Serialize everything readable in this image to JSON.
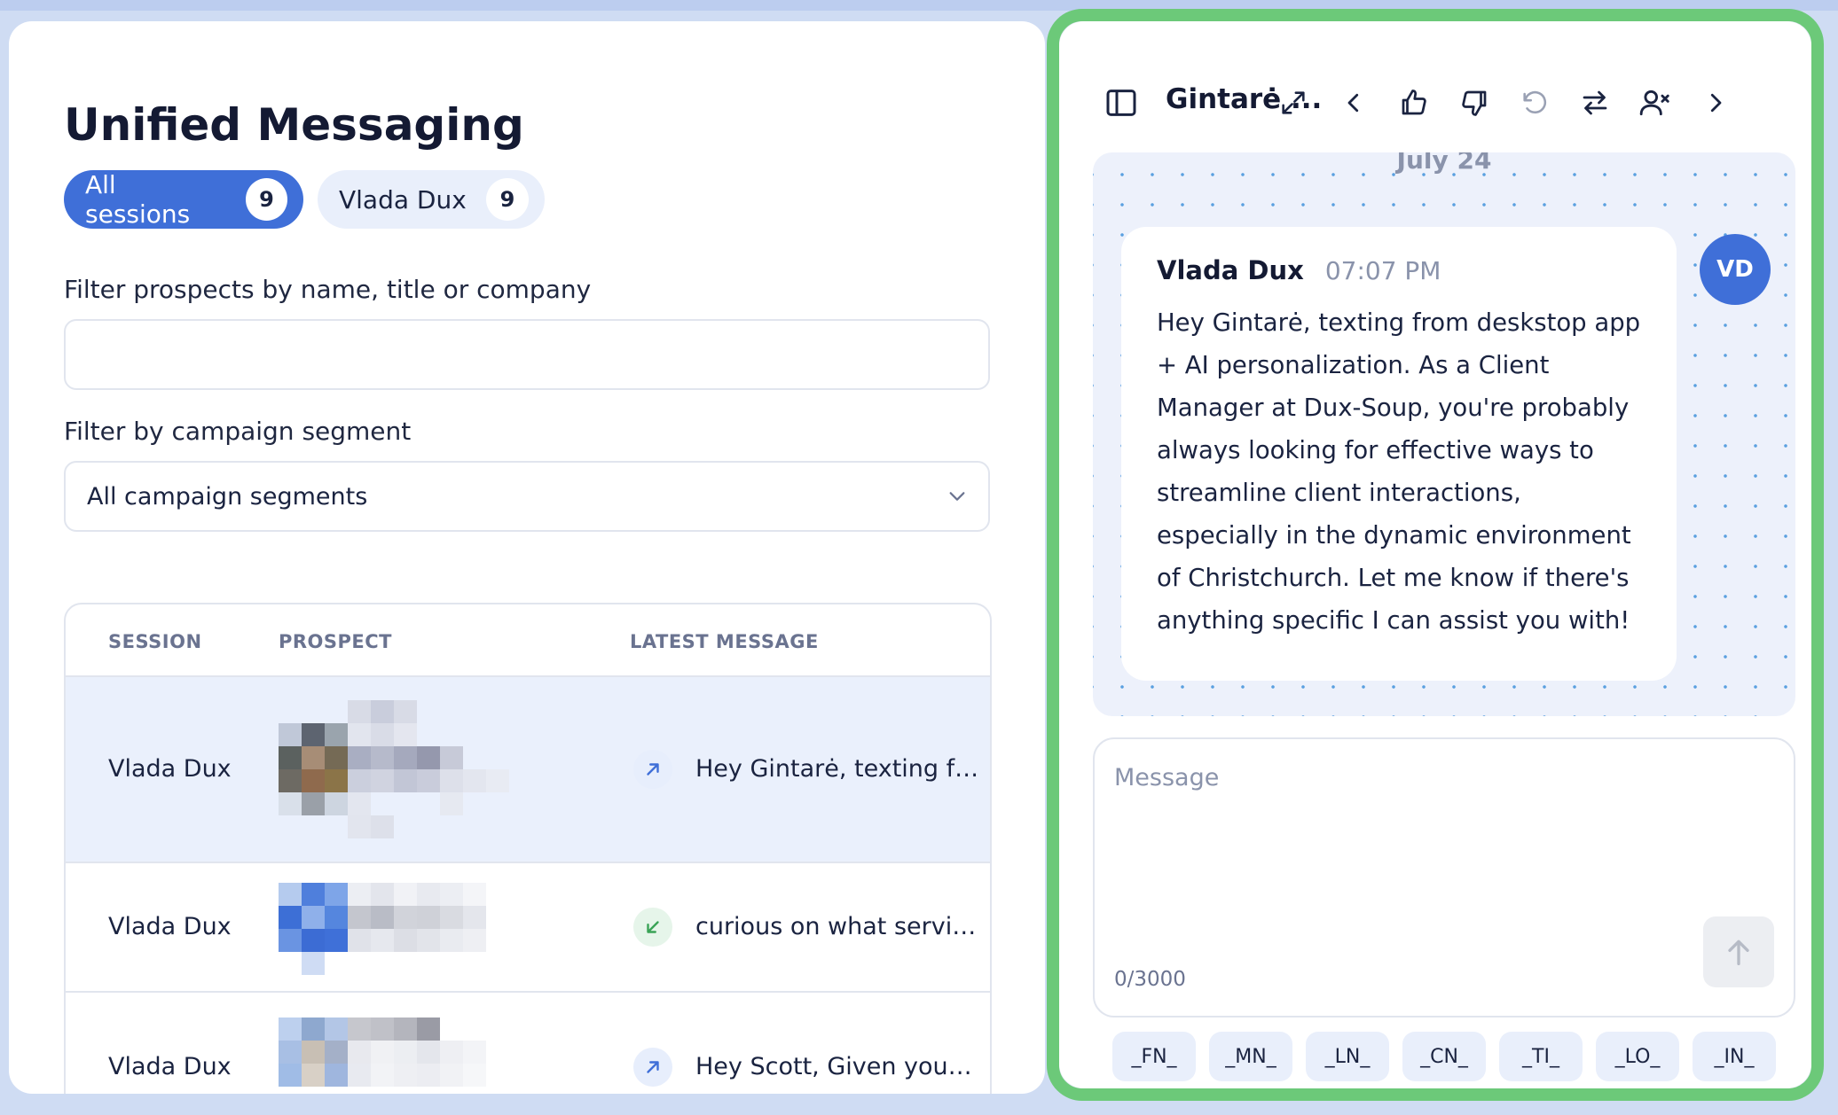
{
  "page": {
    "title": "Unified Messaging"
  },
  "filters": {
    "sessions": [
      {
        "label": "All sessions",
        "count": "9",
        "active": true
      },
      {
        "label": "Vlada Dux",
        "count": "9",
        "active": false
      }
    ],
    "prospect_label": "Filter prospects by name, title or company",
    "prospect_value": "",
    "segment_label": "Filter by campaign segment",
    "segment_value": "All campaign segments"
  },
  "table": {
    "headers": {
      "session": "SESSION",
      "prospect": "PROSPECT",
      "latest_message": "LATEST MESSAGE"
    },
    "rows": [
      {
        "session": "Vlada Dux",
        "direction": "outgoing",
        "message": "Hey Gintarė, texting from deskstop app + AI personalization.",
        "selected": true
      },
      {
        "session": "Vlada Dux",
        "direction": "incoming",
        "message": "curious on what services you provide",
        "selected": false
      },
      {
        "session": "Vlada Dux",
        "direction": "outgoing",
        "message": "Hey Scott, Given your experience",
        "selected": false
      }
    ]
  },
  "conversation": {
    "title": "Gintarė ...",
    "date": "July 24",
    "message": {
      "sender": "Vlada Dux",
      "time": "07:07 PM",
      "text": "Hey Gintarė, texting from deskstop app + AI personalization. As a Client Manager at Dux-Soup, you're probably always looking for effective ways to streamline client interactions, especially in the dynamic environment of Christchurch. Let me know if there's anything specific I can assist you with!",
      "avatar_initials": "VD"
    },
    "compose": {
      "placeholder": "Message",
      "char_count": "0/3000",
      "value": ""
    },
    "tokens": [
      "_FN_",
      "_MN_",
      "_LN_",
      "_CN_",
      "_TI_",
      "_LO_",
      "_IN_"
    ]
  },
  "colors": {
    "accent": "#3f6fd8",
    "panel_border": "#6cc979",
    "selected_row": "#eaf0fc"
  },
  "icons": {
    "toolbar": [
      "sidebar-toggle-icon",
      "expand-icon",
      "chevron-left-icon",
      "thumbs-up-icon",
      "thumbs-down-icon",
      "undo-icon",
      "swap-icon",
      "remove-user-icon",
      "chevron-right-icon"
    ]
  }
}
